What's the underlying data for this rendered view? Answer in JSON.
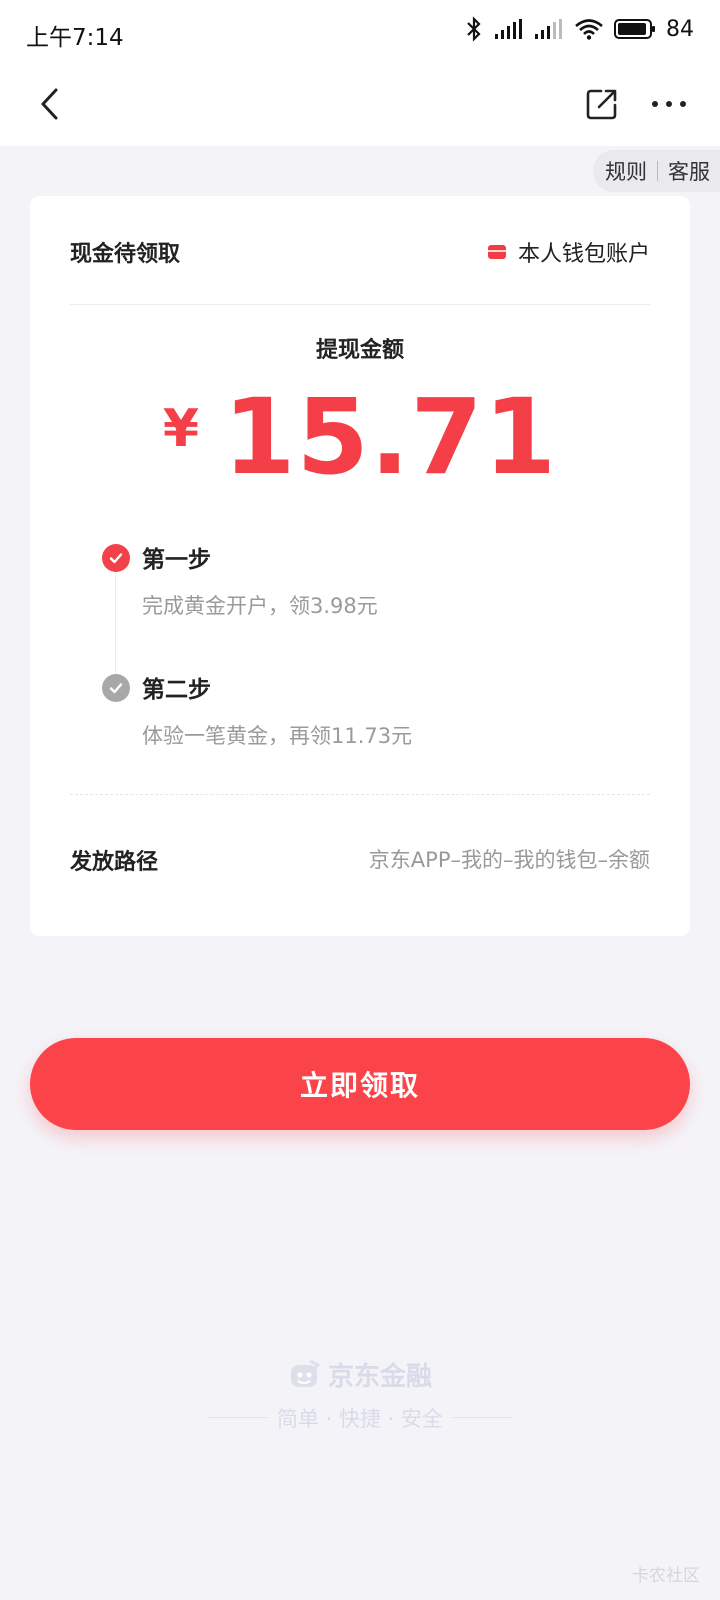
{
  "status_bar": {
    "time": "上午7:14",
    "battery": "84",
    "icons": [
      "bluetooth-icon",
      "signal-icon",
      "signal-icon",
      "wifi-icon",
      "battery-icon"
    ]
  },
  "nav": {
    "back_icon": "chevron-left-icon",
    "share_icon": "share-icon",
    "more_icon": "more-dots-icon"
  },
  "top_links": {
    "rules": "规则",
    "service": "客服"
  },
  "card": {
    "title": "现金待领取",
    "account_label": "本人钱包账户",
    "amount_label": "提现金额",
    "currency": "¥",
    "amount": "15.71",
    "steps": [
      {
        "title": "第一步",
        "desc": "完成黄金开户，领3.98元",
        "status": "done"
      },
      {
        "title": "第二步",
        "desc": "体验一笔黄金，再领11.73元",
        "status": "pending"
      }
    ],
    "path_label": "发放路径",
    "path_value": "京东APP–我的–我的钱包–余额"
  },
  "claim_button": "立即领取",
  "footer": {
    "brand": "京东金融",
    "slogan": "简单 · 快捷 · 安全"
  },
  "watermark": "卡农社区",
  "colors": {
    "accent": "#f43f48",
    "button": "#fb444a",
    "background": "#f4f4f8"
  }
}
